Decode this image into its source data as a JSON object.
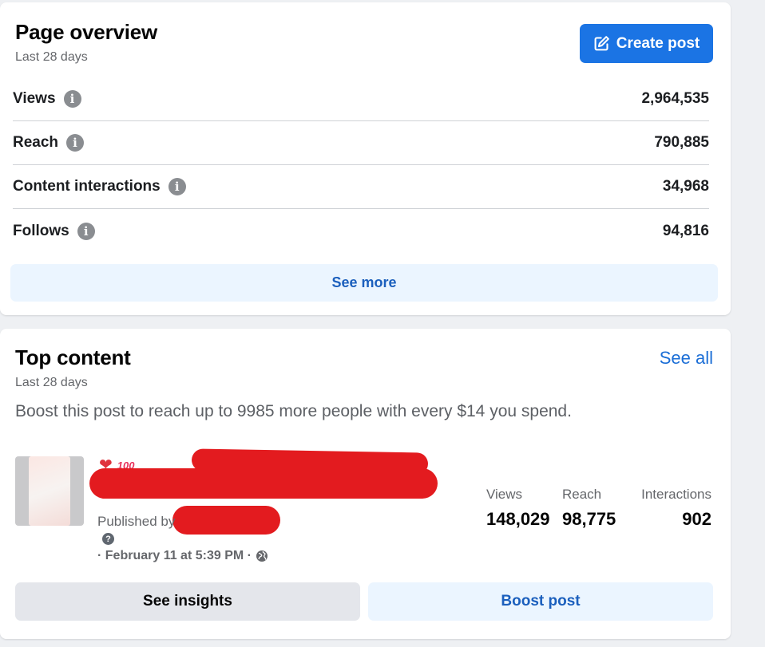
{
  "overview": {
    "title": "Page overview",
    "subtitle": "Last 28 days",
    "create_post_label": "Create post",
    "metrics": [
      {
        "label": "Views",
        "value": "2,964,535"
      },
      {
        "label": "Reach",
        "value": "790,885"
      },
      {
        "label": "Content interactions",
        "value": "34,968"
      },
      {
        "label": "Follows",
        "value": "94,816"
      }
    ],
    "see_more_label": "See more"
  },
  "top_content": {
    "title": "Top content",
    "subtitle": "Last 28 days",
    "see_all_label": "See all",
    "boost_text": "Boost this post to reach up to 9985 more people with every $14 you spend.",
    "post": {
      "reaction_badge": "100",
      "published_by": "Published by",
      "date": "· February 11 at 5:39 PM ·",
      "stats": [
        {
          "label": "Views",
          "value": "148,029"
        },
        {
          "label": "Reach",
          "value": "98,775"
        },
        {
          "label": "Interactions",
          "value": "902"
        }
      ]
    },
    "see_insights_label": "See insights",
    "boost_post_label": "Boost post"
  },
  "colors": {
    "primary": "#1b74e4",
    "link": "#1b6ed6",
    "light_blue_button": "#ebf5ff",
    "gray_button": "#e4e6eb",
    "redaction": "#e31b1f"
  },
  "icons": [
    "edit-icon",
    "info-icon",
    "heart-icon",
    "hundred-icon",
    "help-icon",
    "globe-icon"
  ]
}
